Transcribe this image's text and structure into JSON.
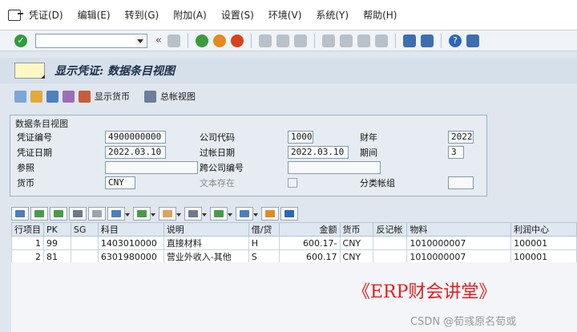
{
  "menu": {
    "items": [
      "凭证(D)",
      "编辑(E)",
      "转到(G)",
      "附加(A)",
      "设置(S)",
      "环境(V)",
      "系统(Y)",
      "帮助(H)"
    ]
  },
  "toolbar": {
    "command_value": "",
    "back_glyph": "«"
  },
  "title": {
    "text": "显示凭证: 数据条目视图"
  },
  "app_toolbar": {
    "display_currency_label": "显示货币",
    "general_ledger_view_label": "总帐视图"
  },
  "header": {
    "group_title": "数据条目视图",
    "doc_number_label": "凭证编号",
    "doc_number": "4900000000",
    "company_code_label": "公司代码",
    "company_code": "1000",
    "fiscal_year_label": "财年",
    "fiscal_year": "2022",
    "doc_date_label": "凭证日期",
    "doc_date": "2022.03.10",
    "posting_date_label": "过帐日期",
    "posting_date": "2022.03.10",
    "period_label": "期间",
    "period": "3",
    "reference_label": "参照",
    "reference": "",
    "cross_cc_label": "跨公司编号",
    "cross_cc": "",
    "currency_label": "货币",
    "currency": "CNY",
    "text_exists_label": "文本存在",
    "ledger_group_label": "分类帐组",
    "ledger_group": ""
  },
  "table": {
    "columns": [
      "行项目",
      "PK",
      "SG",
      "科目",
      "说明",
      "借/贷",
      "金额",
      "货币",
      "反记帐",
      "物料",
      "利润中心"
    ],
    "rows": [
      {
        "item": "1",
        "pk": "99",
        "sg": "",
        "account": "1403010000",
        "desc": "直接材料",
        "dc": "H",
        "amount": "600.17-",
        "currency": "CNY",
        "reversal": "",
        "material": "1010000007",
        "profit_center": "100001"
      },
      {
        "item": "2",
        "pk": "81",
        "sg": "",
        "account": "6301980000",
        "desc": "营业外收入-其他",
        "dc": "S",
        "amount": "600.17",
        "currency": "CNY",
        "reversal": "",
        "material": "1010000007",
        "profit_center": "100001"
      }
    ]
  },
  "watermark": {
    "main": "《ERP财会讲堂》",
    "credit": "CSDN @荀彧原名荀或"
  },
  "colors": {
    "watermark_red": "#e11f1f",
    "title_bg": "#d6e0ea",
    "ok_green": "#2f9d3b"
  }
}
